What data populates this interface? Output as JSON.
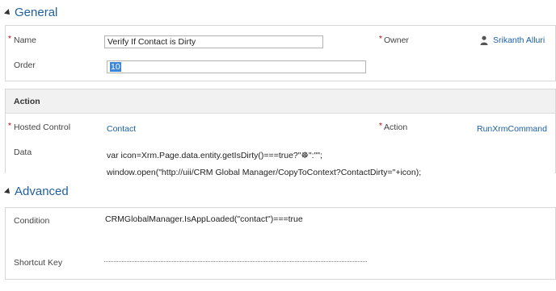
{
  "general": {
    "title": "General",
    "name_label": "Name",
    "name_value": "Verify If Contact is Dirty",
    "order_label": "Order",
    "order_value": "10",
    "owner_label": "Owner",
    "owner_value": "Srikanth Alluri",
    "required_mark": "*"
  },
  "action": {
    "title": "Action",
    "hosted_control_label": "Hosted Control",
    "hosted_control_value": "Contact",
    "action_label": "Action",
    "action_value": "RunXrmCommand",
    "data_label": "Data",
    "data_line1": "var icon=Xrm.Page.data.entity.getIsDirty()===true?\"☸\":\"\";",
    "data_line2": "window.open(\"http://uii/CRM Global Manager/CopyToContext?ContactDirty=\"+icon);"
  },
  "advanced": {
    "title": "Advanced",
    "condition_label": "Condition",
    "condition_value": "CRMGlobalManager.IsAppLoaded(\"contact\")===true",
    "shortcut_label": "Shortcut Key",
    "shortcut_value": ""
  }
}
